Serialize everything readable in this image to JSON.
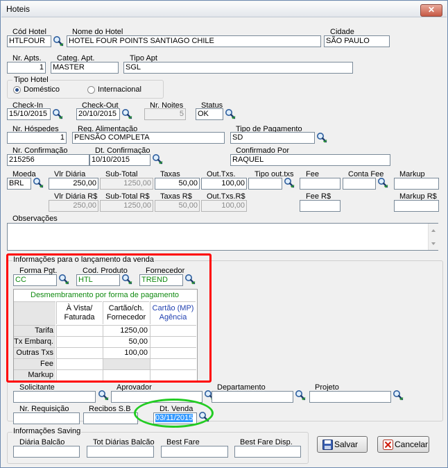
{
  "window": {
    "title": "Hoteis",
    "close_glyph": "✕"
  },
  "hotel": {
    "cod_label": "Cód Hotel",
    "cod": "HTLFOUR",
    "nome_label": "Nome do Hotel",
    "nome": "HOTEL  FOUR POINTS  SANTIAGO  CHILE",
    "cidade_label": "Cidade",
    "cidade": "SÃO PAULO"
  },
  "apt": {
    "nr_label": "Nr. Apts.",
    "nr": "1",
    "categ_label": "Categ. Apt.",
    "categ": "MASTER",
    "tipo_label": "Tipo Apt",
    "tipo": "SGL"
  },
  "tipo_hotel": {
    "label": "Tipo Hotel",
    "domestico": "Doméstico",
    "internacional": "Internacional",
    "selected": "domestico"
  },
  "stay": {
    "checkin_label": "Check-In",
    "checkin": "15/10/2015",
    "checkout_label": "Check-Out",
    "checkout": "20/10/2015",
    "noites_label": "Nr. Noites",
    "noites": "5",
    "status_label": "Status",
    "status": "OK"
  },
  "guests": {
    "hospedes_label": "Nr. Hóspedes",
    "hospedes": "1",
    "alim_label": "Req. Alimentação",
    "alim": "PENSÃO COMPLETA",
    "pagto_label": "Tipo de Pagamento",
    "pagto": "SD"
  },
  "confirm": {
    "nr_label": "Nr. Confirmação",
    "nr": "215256",
    "dt_label": "Dt. Confirmação",
    "dt": "10/10/2015",
    "por_label": "Confirmado Por",
    "por": "RAQUEL"
  },
  "values": {
    "moeda_label": "Moeda",
    "moeda": "BRL",
    "vlr_diaria_label": "Vlr Diária",
    "vlr_diaria": "250,00",
    "subtotal_label": "Sub-Total",
    "subtotal": "1250,00",
    "taxas_label": "Taxas",
    "taxas": "50,00",
    "outtxs_label": "Out.Txs.",
    "outtxs": "100,00",
    "tipo_outtxs_label": "Tipo out.txs",
    "tipo_outtxs": "",
    "fee_label": "Fee",
    "fee": "",
    "conta_fee_label": "Conta Fee",
    "conta_fee": "",
    "markup_label": "Markup",
    "markup": "",
    "vlr_diaria_rs_label": "Vlr Diária R$",
    "vlr_diaria_rs": "250,00",
    "subtotal_rs_label": "Sub-Total R$",
    "subtotal_rs": "1250,00",
    "taxas_rs_label": "Taxas R$",
    "taxas_rs": "50,00",
    "outtxs_rs_label": "Out.Txs.R$",
    "outtxs_rs": "100,00",
    "fee_rs_label": "Fee R$",
    "fee_rs": "",
    "markup_rs_label": "Markup R$",
    "markup_rs": ""
  },
  "obs": {
    "label": "Observações",
    "text": ""
  },
  "venda": {
    "label": "Informações para o lançamento da venda",
    "forma_label": "Forma Pgt.",
    "forma": "CC",
    "cod_prod_label": "Cod. Produto",
    "cod_prod": "HTL",
    "fornecedor_label": "Fornecedor",
    "fornecedor": "TREND",
    "table": {
      "title": "Desmembramento por forma de pagamento",
      "headers": [
        "À Vista/\nFaturada",
        "Cartão/ch.\nFornecedor",
        "Cartão (MP)\nAgência"
      ],
      "rows": [
        {
          "label": "Tarifa",
          "cells": [
            "",
            "1250,00",
            ""
          ]
        },
        {
          "label": "Tx Embarq.",
          "cells": [
            "",
            "50,00",
            ""
          ]
        },
        {
          "label": "Outras Txs",
          "cells": [
            "",
            "100,00",
            ""
          ]
        },
        {
          "label": "Fee",
          "cells": [
            "",
            "",
            ""
          ]
        },
        {
          "label": "Markup",
          "cells": [
            "",
            "",
            ""
          ]
        }
      ]
    }
  },
  "people": {
    "solicitante_label": "Solicitante",
    "solicitante": "",
    "aprovador_label": "Aprovador",
    "aprovador": "",
    "departamento_label": "Departamento",
    "departamento": "",
    "projeto_label": "Projeto",
    "projeto": ""
  },
  "req": {
    "nr_label": "Nr. Requisição",
    "nr": "",
    "recibos_label": "Recibos S.B",
    "recibos": "",
    "dt_venda_label": "Dt. Venda",
    "dt_venda": "03/11/2015"
  },
  "saving": {
    "label": "Informações Saving",
    "diaria_label": "Diária Balcão",
    "diaria": "",
    "tot_label": "Tot Diárias Balcão",
    "tot": "",
    "best_label": "Best Fare",
    "best": "",
    "best_disp_label": "Best Fare Disp.",
    "best_disp": ""
  },
  "buttons": {
    "salvar": "Salvar",
    "cancelar": "Cancelar"
  },
  "colors": {
    "highlight_red": "#ff0000",
    "highlight_green": "#22cc22",
    "input_green": "#108a10",
    "mp_blue": "#1f3fb0"
  }
}
